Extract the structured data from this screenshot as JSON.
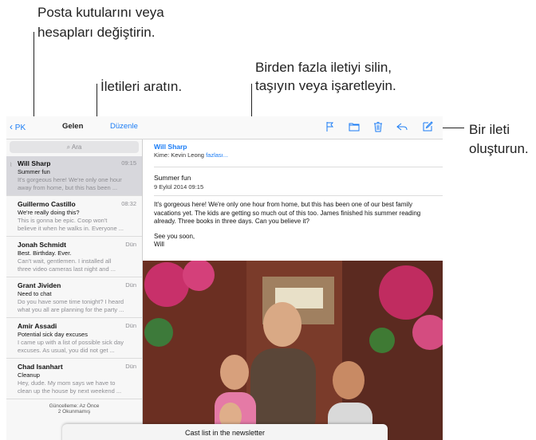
{
  "callouts": {
    "switch_mailbox": [
      "Posta kutularını veya",
      "hesapları değiştirin."
    ],
    "search": "İletileri aratın.",
    "delete_move": [
      "Birden fazla iletiyi silin,",
      "taşıyın veya işaretleyin."
    ],
    "compose": [
      "Bir ileti",
      "oluşturun."
    ]
  },
  "nav": {
    "back_label": "PK",
    "title": "Gelen",
    "edit_label": "Düzenle"
  },
  "search": {
    "placeholder": "Ara"
  },
  "messages": [
    {
      "sender": "Will Sharp",
      "date": "09:15",
      "subject": "Summer fun",
      "preview1": "It's gorgeous here! We're only one hour",
      "preview2": "away from home, but this has been ..."
    },
    {
      "sender": "Guillermo Castillo",
      "date": "08:32",
      "subject": "We're really doing this?",
      "preview1": "This is gonna be epic. Coop won't",
      "preview2": "believe it when he walks in. Everyone ..."
    },
    {
      "sender": "Jonah Schmidt",
      "date": "Dün",
      "subject": "Best. Birthday. Ever.",
      "preview1": "Can't wait, gentlemen. I installed all",
      "preview2": "three video cameras last night and ..."
    },
    {
      "sender": "Grant Jividen",
      "date": "Dün",
      "subject": "Need to chat",
      "preview1": "Do you have some time tonight? I heard",
      "preview2": "what you all are planning for the party ..."
    },
    {
      "sender": "Amir Assadi",
      "date": "Dün",
      "subject": "Potential sick day excuses",
      "preview1": "I came up with a list of possible sick day",
      "preview2": "excuses. As usual, you did not get ..."
    },
    {
      "sender": "Chad Isanhart",
      "date": "Dün",
      "subject": "Cleanup",
      "preview1": "Hey, dude. My mom says we have to",
      "preview2": "clean up the house by next weekend ..."
    }
  ],
  "footer": {
    "updated": "Güncelleme: Az Önce",
    "unread": "2 Okunmamış"
  },
  "detail": {
    "from": "Will Sharp",
    "to_prefix": "Kime: Kevin Leong",
    "to_more": "fazlası...",
    "subject": "Summer fun",
    "date": "9 Eylül 2014 09:15",
    "body": "It's gorgeous here! We're only one hour from home, but this has been one of our best family vacations yet. The kids are getting so much out of this too. James finished his summer reading already. Three books in three days. Can you believe it?",
    "signoff1": "See you soon,",
    "signoff2": "Will"
  },
  "sheet": {
    "title": "Cast list in the newsletter"
  },
  "colors": {
    "accent": "#1a7cf5",
    "selected_row": "#d7d7dc"
  }
}
